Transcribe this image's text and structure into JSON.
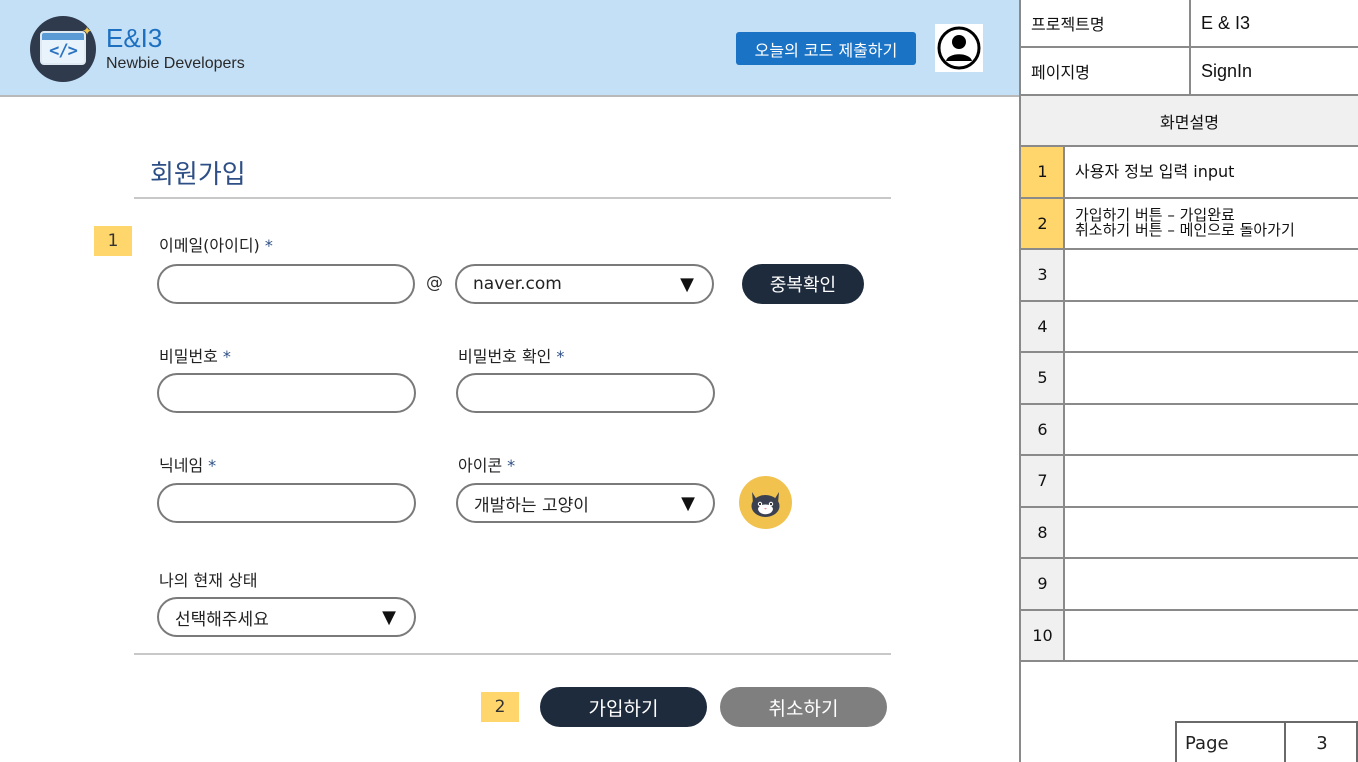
{
  "header": {
    "brand": "E&I3",
    "brand_sub": "Newbie Developers",
    "submit_code_label": "오늘의 코드 제출하기"
  },
  "form": {
    "title": "회원가입",
    "email_label": "이메일(아이디)",
    "required_mark": "*",
    "at_sign": "@",
    "email_domain_value": "naver.com",
    "dup_check_label": "중복확인",
    "password_label": "비밀번호",
    "password_confirm_label": "비밀번호 확인",
    "nickname_label": "닉네임",
    "icon_label": "아이콘",
    "icon_value": "개발하는 고양이",
    "status_label": "나의 현재 상태",
    "status_value": "선택해주세요",
    "join_label": "가입하기",
    "cancel_label": "취소하기",
    "dropdown_arrow": "▼"
  },
  "markers": [
    "1",
    "2"
  ],
  "panel": {
    "project_label": "프로젝트명",
    "project_value": "E & I3",
    "page_label": "페이지명",
    "page_value": "SignIn",
    "desc_title": "화면설명",
    "rows": [
      {
        "num": "1",
        "lines": [
          "사용자 정보 입력 input"
        ]
      },
      {
        "num": "2",
        "lines": [
          "가입하기 버튼 – 가입완료",
          "취소하기 버튼 – 메인으로 돌아가기"
        ]
      },
      {
        "num": "3",
        "lines": []
      },
      {
        "num": "4",
        "lines": []
      },
      {
        "num": "5",
        "lines": []
      },
      {
        "num": "6",
        "lines": []
      },
      {
        "num": "7",
        "lines": []
      },
      {
        "num": "8",
        "lines": []
      },
      {
        "num": "9",
        "lines": []
      },
      {
        "num": "10",
        "lines": []
      }
    ],
    "footer_page_label": "Page",
    "footer_page_num": "3"
  },
  "colors": {
    "header_bg": "#c4e0f7",
    "accent_blue": "#1b73c6",
    "dark_button": "#1e2b3d",
    "gray_button": "#7f7f7f",
    "marker_yellow": "#ffd66b"
  },
  "icons": {
    "logo": "code-window-icon",
    "profile": "user-avatar-icon",
    "cat": "cat-avatar-icon"
  }
}
